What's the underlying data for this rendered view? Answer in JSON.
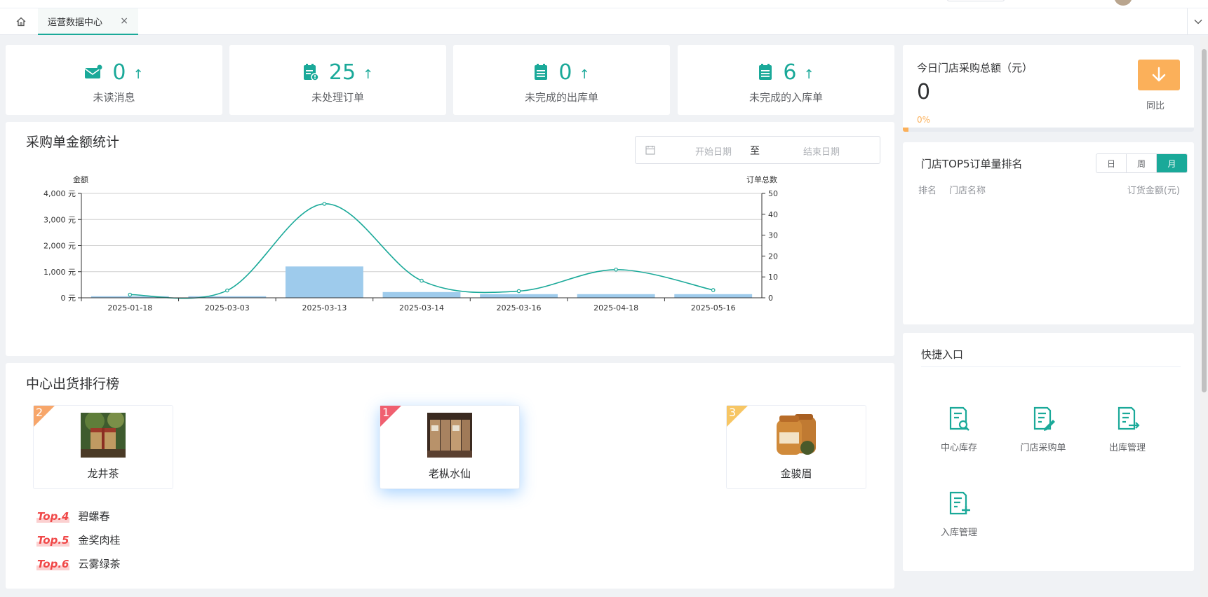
{
  "tabs": {
    "active_label": "运营数据中心",
    "close_glyph": "×"
  },
  "stats": [
    {
      "icon": "envelope-icon",
      "value": "0",
      "arrow": "↑",
      "label": "未读消息"
    },
    {
      "icon": "clipboard-alert-icon",
      "value": "25",
      "arrow": "↑",
      "label": "未处理订单"
    },
    {
      "icon": "clipboard-list-icon",
      "value": "0",
      "arrow": "↑",
      "label": "未完成的出库单"
    },
    {
      "icon": "clipboard-list-icon",
      "value": "6",
      "arrow": "↑",
      "label": "未完成的入库单"
    }
  ],
  "purchase_panel": {
    "title": "采购单金额统计",
    "date_start_placeholder": "开始日期",
    "date_separator": "至",
    "date_end_placeholder": "结束日期"
  },
  "chart_data": {
    "type": "bar",
    "title": "",
    "categories": [
      "2025-01-18",
      "2025-03-03",
      "2025-03-13",
      "2025-03-14",
      "2025-03-16",
      "2025-04-18",
      "2025-05-16"
    ],
    "series": [
      {
        "name": "金额",
        "type": "bar",
        "axis": "left",
        "values": [
          60,
          60,
          1200,
          220,
          140,
          140,
          140
        ],
        "color": "#9ecbec"
      },
      {
        "name": "订单总数",
        "type": "line",
        "axis": "right",
        "values": [
          1.5,
          3.5,
          45,
          8.2,
          3.2,
          13.5,
          3.7
        ],
        "color": "#1aa999"
      }
    ],
    "ylabel": "金额",
    "y2label": "订单总数",
    "ylim": [
      0,
      4000
    ],
    "y2lim": [
      0,
      50
    ],
    "y_ticks": [
      "0 元",
      "1,000 元",
      "2,000 元",
      "3,000 元",
      "4,000 元"
    ],
    "y_tick_values": [
      0,
      1000,
      2000,
      3000,
      4000
    ],
    "y2_ticks": [
      "0",
      "10",
      "20",
      "30",
      "40",
      "50"
    ],
    "y2_tick_values": [
      0,
      10,
      20,
      30,
      40,
      50
    ],
    "grid": true
  },
  "ranking": {
    "title": "中心出货排行榜",
    "podium": [
      {
        "rank": "2",
        "name": "龙井茶",
        "color": "#f7a66a"
      },
      {
        "rank": "1",
        "name": "老枞水仙",
        "color": "#f06070"
      },
      {
        "rank": "3",
        "name": "金骏眉",
        "color": "#f7c664"
      }
    ],
    "list": [
      {
        "tag": "Top.4",
        "name": "碧螺春"
      },
      {
        "tag": "Top.5",
        "name": "金奖肉桂"
      },
      {
        "tag": "Top.6",
        "name": "云雾绿茶"
      }
    ]
  },
  "today": {
    "title": "今日门店采购总额（元）",
    "value": "0",
    "percent": "0%",
    "yoy_label": "同比",
    "progress_fraction": 0
  },
  "top5": {
    "title": "门店TOP5订单量排名",
    "segments": [
      "日",
      "周",
      "月"
    ],
    "active_segment": "月",
    "columns": {
      "rank": "排名",
      "store": "门店名称",
      "amount": "订货金额(元)"
    }
  },
  "quick_entry": {
    "title": "快捷入口",
    "items": [
      {
        "icon": "document-search-icon",
        "label": "中心库存"
      },
      {
        "icon": "document-edit-icon",
        "label": "门店采购单"
      },
      {
        "icon": "document-export-icon",
        "label": "出库管理"
      },
      {
        "icon": "document-add-icon",
        "label": "入库管理"
      }
    ]
  },
  "colors": {
    "accent": "#1aa999",
    "orange": "#fbb05a",
    "red": "#f04848"
  }
}
